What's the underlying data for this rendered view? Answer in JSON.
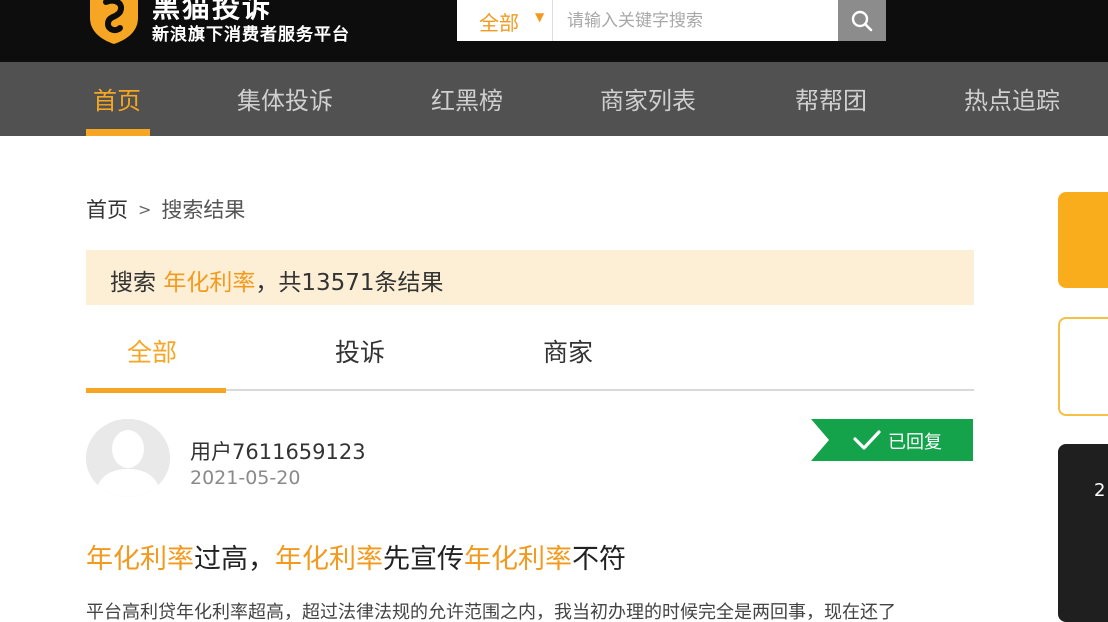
{
  "header": {
    "logo_title": "黑猫投诉",
    "logo_subtitle": "新浪旗下消费者服务平台",
    "search": {
      "scope_label": "全部",
      "placeholder": "请输入关键字搜索"
    }
  },
  "nav": {
    "items": [
      {
        "label": "首页",
        "active": true
      },
      {
        "label": "集体投诉",
        "active": false
      },
      {
        "label": "红黑榜",
        "active": false
      },
      {
        "label": "商家列表",
        "active": false
      },
      {
        "label": "帮帮团",
        "active": false
      },
      {
        "label": "热点追踪",
        "active": false
      }
    ]
  },
  "breadcrumb": {
    "home": "首页",
    "separator": ">",
    "current": "搜索结果"
  },
  "result_banner": {
    "prefix": "搜索 ",
    "keyword": "年化利率",
    "suffix": "，共13571条结果"
  },
  "tabs": [
    {
      "label": "全部",
      "active": true
    },
    {
      "label": "投诉",
      "active": false
    },
    {
      "label": "商家",
      "active": false
    }
  ],
  "post": {
    "username": "用户7611659123",
    "date": "2021-05-20",
    "status": "已回复",
    "title_parts": [
      {
        "text": "年化利率",
        "highlight": true
      },
      {
        "text": "过高，",
        "highlight": false
      },
      {
        "text": "年化利率",
        "highlight": true
      },
      {
        "text": "先宣传",
        "highlight": false
      },
      {
        "text": "年化利率",
        "highlight": true
      },
      {
        "text": "不符",
        "highlight": false
      }
    ],
    "excerpt": "平台高利贷年化利率超高，超过法律法规的允许范围之内，我当初办理的时候完全是两回事，现在还了"
  },
  "side_widgets": {
    "third_label": "2"
  },
  "colors": {
    "accent": "#f6a623",
    "highlight_text": "#f39a1e",
    "banner_bg": "#fdefd6",
    "status_green": "#14a24b",
    "header_bg": "#0d0d0d",
    "nav_bg": "#515151"
  }
}
